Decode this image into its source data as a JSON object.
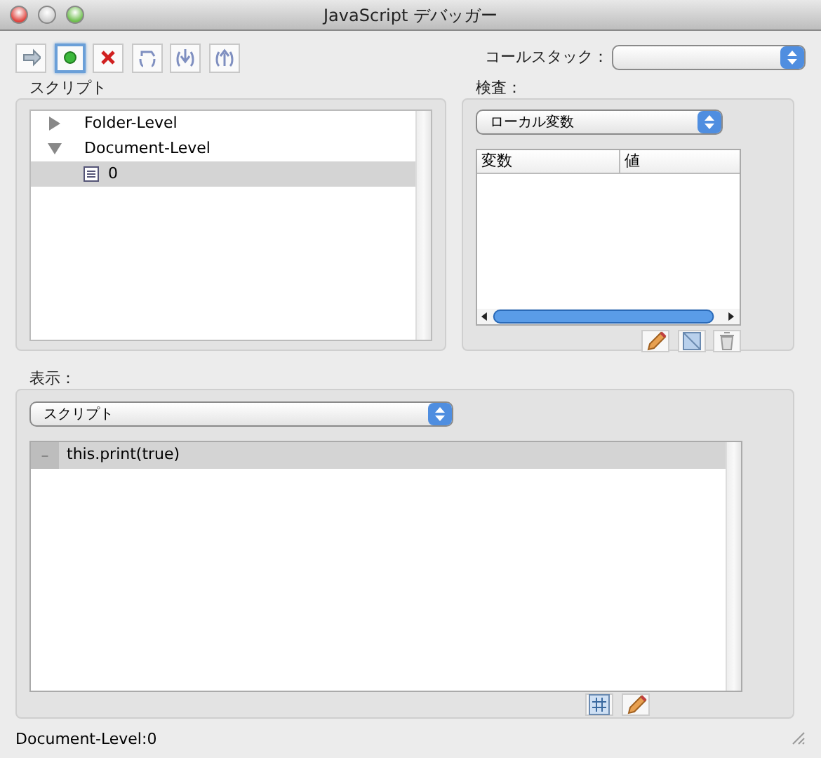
{
  "window": {
    "title": "JavaScript デバッガー"
  },
  "toolbar": [
    {
      "kind": "continue",
      "selected": false
    },
    {
      "kind": "breakpoint",
      "selected": true
    },
    {
      "kind": "stop",
      "selected": false
    },
    {
      "kind": "step-over",
      "selected": false
    },
    {
      "kind": "step-into",
      "selected": false
    },
    {
      "kind": "step-out",
      "selected": false
    }
  ],
  "call_stack": {
    "label": "コールスタック："
  },
  "scripts": {
    "label": "スクリプト",
    "tree": [
      {
        "label": "Folder-Level",
        "expanded": false,
        "selected": false
      },
      {
        "label": "Document-Level",
        "expanded": true,
        "selected": false,
        "children": [
          {
            "label": "0",
            "selected": true
          }
        ]
      }
    ]
  },
  "inspect": {
    "label": "検査：",
    "dropdown": "ローカル変数",
    "columns": [
      "変数",
      "値"
    ],
    "tools": [
      {
        "kind": "edit"
      },
      {
        "kind": "watch"
      },
      {
        "kind": "delete"
      }
    ]
  },
  "display": {
    "label": "表示：",
    "dropdown": "スクリプト",
    "lines": [
      {
        "marker": "–",
        "code": "this.print(true)",
        "selected": true
      }
    ],
    "tools": [
      {
        "kind": "line-numbers"
      },
      {
        "kind": "edit"
      }
    ]
  },
  "status_bar": "Document-Level:0"
}
